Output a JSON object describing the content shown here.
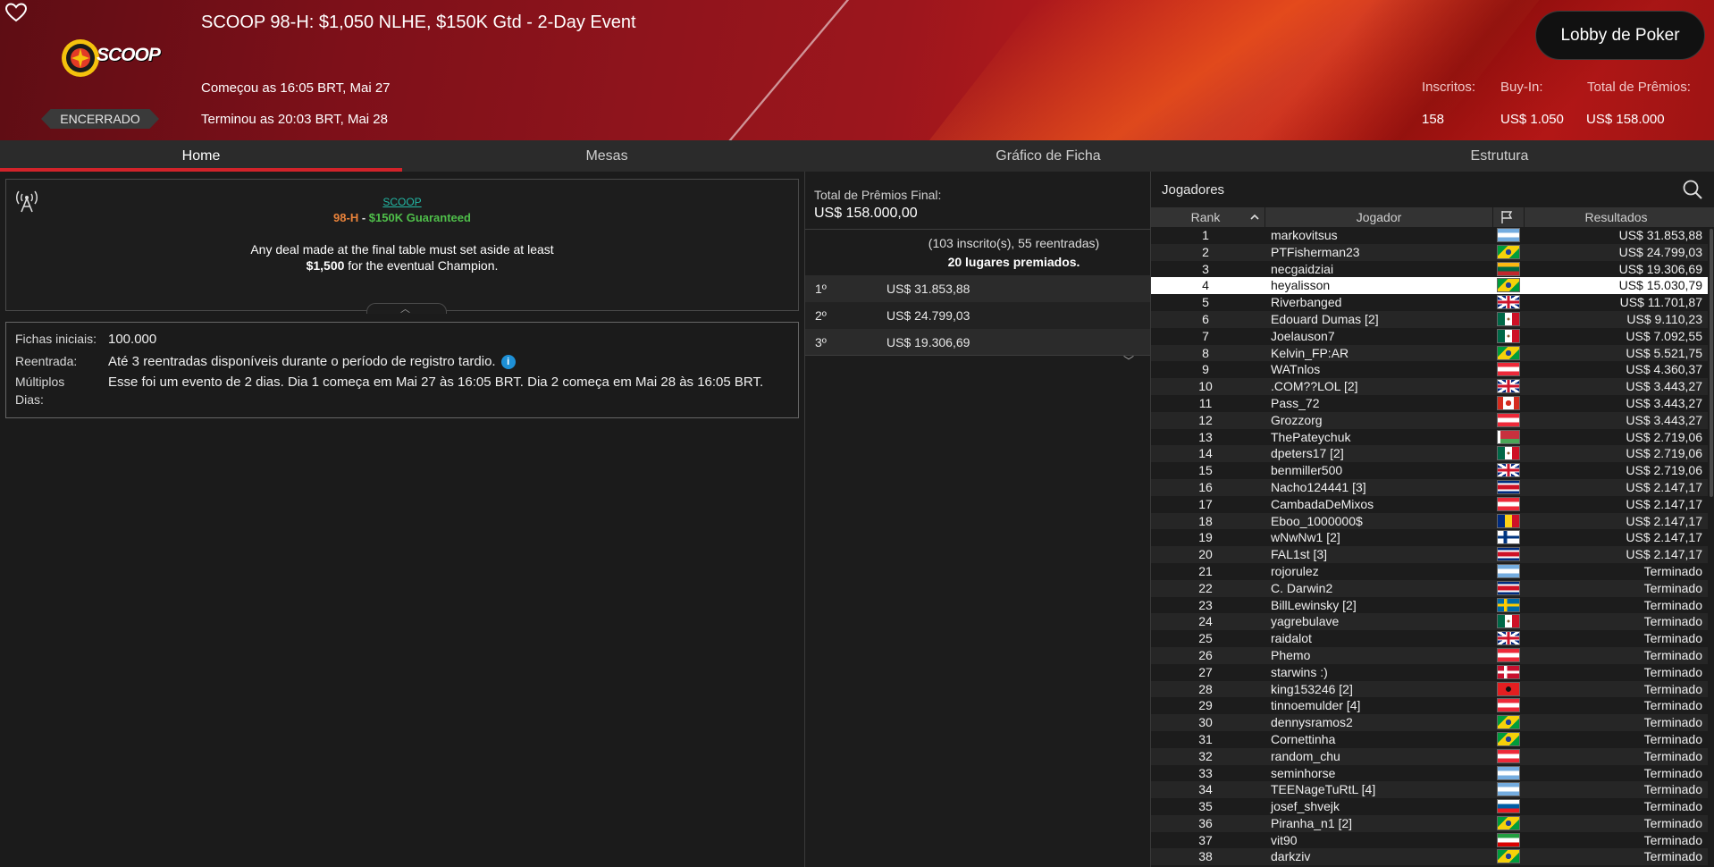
{
  "header": {
    "title": "SCOOP 98-H: $1,050 NLHE, $150K Gtd - 2-Day Event",
    "started": "Começou as 16:05 BRT, Mai 27",
    "ended": "Terminou as 20:03 BRT, Mai 28",
    "status": "ENCERRADO",
    "logo_text": "SCOOP",
    "lobby_button": "Lobby de Poker",
    "stats": {
      "registered_label": "Inscritos:",
      "registered_value": "158",
      "buyin_label": "Buy-In:",
      "buyin_value": "US$ 1.050",
      "prize_label": "Total de Prêmios:",
      "prize_value": "US$ 158.000"
    },
    "accent_color": "#d2232a"
  },
  "tabs": [
    {
      "label": "Home",
      "active": true
    },
    {
      "label": "Mesas",
      "active": false
    },
    {
      "label": "Gráfico de Ficha",
      "active": false
    },
    {
      "label": "Estrutura",
      "active": false
    }
  ],
  "info": {
    "brand": "SCOOP",
    "event_code": "98-H",
    "dash": " - ",
    "guarantee": "$150K Guaranteed",
    "line1": "Any deal made at the final table must set aside at least",
    "line2_bold": "$1,500",
    "line2_rest": " for the eventual Champion."
  },
  "details": {
    "chips_label": "Fichas iniciais:",
    "chips_value": "100.000",
    "reentry_label": "Reentrada:",
    "reentry_value": "Até 3 reentradas disponíveis durante o período de registro tardio.",
    "multiday_label1": "Múltiplos",
    "multiday_label2": "Dias:",
    "multiday_value": "Esse foi um evento de 2 dias. Dia 1 começa em Mai 27 às 16:05 BRT. Dia 2 começa em Mai 28 às 16:05 BRT."
  },
  "prizes": {
    "total_label": "Total de Prêmios Final:",
    "total_value": "US$ 158.000,00",
    "entries": "(103 inscrito(s), 55 reentradas)",
    "paid": "20 lugares premiados.",
    "places": [
      {
        "place": "1º",
        "amount": "US$ 31.853,88"
      },
      {
        "place": "2º",
        "amount": "US$ 24.799,03"
      },
      {
        "place": "3º",
        "amount": "US$ 19.306,69"
      }
    ]
  },
  "players": {
    "title": "Jogadores",
    "columns": {
      "rank": "Rank",
      "player": "Jogador",
      "results": "Resultados"
    },
    "rows": [
      {
        "rank": "1",
        "name": "markovitsus",
        "flag": "AR",
        "result": "US$ 31.853,88"
      },
      {
        "rank": "2",
        "name": "PTFisherman23",
        "flag": "BR",
        "result": "US$ 24.799,03"
      },
      {
        "rank": "3",
        "name": "necgaidziai",
        "flag": "LT",
        "result": "US$ 19.306,69"
      },
      {
        "rank": "4",
        "name": "heyalisson",
        "flag": "BR",
        "result": "US$ 15.030,79",
        "selected": true
      },
      {
        "rank": "5",
        "name": "Riverbanged",
        "flag": "GB",
        "result": "US$ 11.701,87"
      },
      {
        "rank": "6",
        "name": "Edouard Dumas [2]",
        "flag": "MX",
        "result": "US$ 9.110,23"
      },
      {
        "rank": "7",
        "name": "Joelauson7",
        "flag": "MX",
        "result": "US$ 7.092,55"
      },
      {
        "rank": "8",
        "name": "Kelvin_FP:AR",
        "flag": "BR",
        "result": "US$ 5.521,75"
      },
      {
        "rank": "9",
        "name": "WATnlos",
        "flag": "AT",
        "result": "US$ 4.360,37"
      },
      {
        "rank": "10",
        "name": ".COM??LOL [2]",
        "flag": "GB",
        "result": "US$ 3.443,27"
      },
      {
        "rank": "11",
        "name": "Pass_72",
        "flag": "CA",
        "result": "US$ 3.443,27"
      },
      {
        "rank": "12",
        "name": "Grozzorg",
        "flag": "AT",
        "result": "US$ 3.443,27"
      },
      {
        "rank": "13",
        "name": "ThePateychuk",
        "flag": "BY",
        "result": "US$ 2.719,06"
      },
      {
        "rank": "14",
        "name": "dpeters17 [2]",
        "flag": "MX",
        "result": "US$ 2.719,06"
      },
      {
        "rank": "15",
        "name": "benmiller500",
        "flag": "GB",
        "result": "US$ 2.719,06"
      },
      {
        "rank": "16",
        "name": "Nacho124441 [3]",
        "flag": "CR",
        "result": "US$ 2.147,17"
      },
      {
        "rank": "17",
        "name": "CambadaDeMixos",
        "flag": "AT",
        "result": "US$ 2.147,17"
      },
      {
        "rank": "18",
        "name": "Eboo_1000000$",
        "flag": "RO",
        "result": "US$ 2.147,17"
      },
      {
        "rank": "19",
        "name": "wNwNw1 [2]",
        "flag": "FI",
        "result": "US$ 2.147,17"
      },
      {
        "rank": "20",
        "name": "FAL1st [3]",
        "flag": "CR",
        "result": "US$ 2.147,17"
      },
      {
        "rank": "21",
        "name": "rojorulez",
        "flag": "AR",
        "result": "Terminado"
      },
      {
        "rank": "22",
        "name": "C. Darwin2",
        "flag": "CR",
        "result": "Terminado"
      },
      {
        "rank": "23",
        "name": "BillLewinsky [2]",
        "flag": "SE",
        "result": "Terminado"
      },
      {
        "rank": "24",
        "name": "yagrebulave",
        "flag": "MX",
        "result": "Terminado"
      },
      {
        "rank": "25",
        "name": "raidalot",
        "flag": "GB",
        "result": "Terminado"
      },
      {
        "rank": "26",
        "name": "Phemo",
        "flag": "AT",
        "result": "Terminado"
      },
      {
        "rank": "27",
        "name": "starwins :)",
        "flag": "DK",
        "result": "Terminado"
      },
      {
        "rank": "28",
        "name": "king153246 [2]",
        "flag": "AL",
        "result": "Terminado"
      },
      {
        "rank": "29",
        "name": "tinnoemulder [4]",
        "flag": "AT",
        "result": "Terminado"
      },
      {
        "rank": "30",
        "name": "dennysramos2",
        "flag": "BR",
        "result": "Terminado"
      },
      {
        "rank": "31",
        "name": "Cornettinha",
        "flag": "BR",
        "result": "Terminado"
      },
      {
        "rank": "32",
        "name": "random_chu",
        "flag": "AT",
        "result": "Terminado"
      },
      {
        "rank": "33",
        "name": "seminhorse",
        "flag": "AR",
        "result": "Terminado"
      },
      {
        "rank": "34",
        "name": "TEENageTuRtL [4]",
        "flag": "AR",
        "result": "Terminado"
      },
      {
        "rank": "35",
        "name": "josef_shvejk",
        "flag": "SI",
        "result": "Terminado"
      },
      {
        "rank": "36",
        "name": "Piranha_n1 [2]",
        "flag": "BR",
        "result": "Terminado"
      },
      {
        "rank": "37",
        "name": "vit90",
        "flag": "IR",
        "result": "Terminado"
      },
      {
        "rank": "38",
        "name": "darkziv",
        "flag": "BR",
        "result": "Terminado"
      }
    ]
  }
}
